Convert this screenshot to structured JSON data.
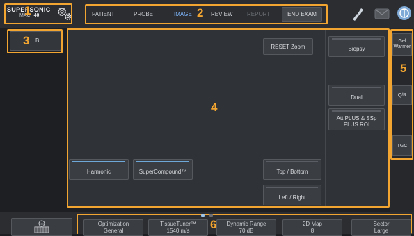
{
  "logo": {
    "brand_a": "SUPER",
    "brand_b": "SONIC",
    "model_a": "MACH",
    "model_b": "40"
  },
  "nav": {
    "tabs": [
      {
        "label": "PATIENT"
      },
      {
        "label": "PROBE"
      },
      {
        "label": "IMAGE"
      },
      {
        "label": "REVIEW"
      },
      {
        "label": "REPORT"
      }
    ],
    "end_exam": "END EXAM"
  },
  "mode": {
    "label": "B"
  },
  "image_area": {
    "reset_zoom": "RESET Zoom",
    "harmonic": "Harmonic",
    "supercompound": "SuperCompound™",
    "top_bottom": "Top / Bottom",
    "left_right": "Left / Right",
    "biopsy": "Biopsy",
    "dual": "Dual",
    "att_plus": "Att PLUS & SSp PLUS ROI"
  },
  "side": {
    "gel_warmer": "Gel Warmer",
    "qr": "Q/R",
    "tgc": "TGC"
  },
  "params": [
    {
      "name": "Optimization",
      "value": "General"
    },
    {
      "name": "TissueTuner™",
      "value": "1540 m/s"
    },
    {
      "name": "Dynamic Range",
      "value": "70 dB"
    },
    {
      "name": "2D Map",
      "value": "8"
    },
    {
      "name": "Sector",
      "value": "Large"
    }
  ],
  "callouts": [
    "1",
    "2",
    "3",
    "4",
    "5",
    "6"
  ],
  "colors": {
    "accent_orange": "#f2a531",
    "active_blue": "#7fb7ff",
    "panel": "#2b2d31"
  }
}
